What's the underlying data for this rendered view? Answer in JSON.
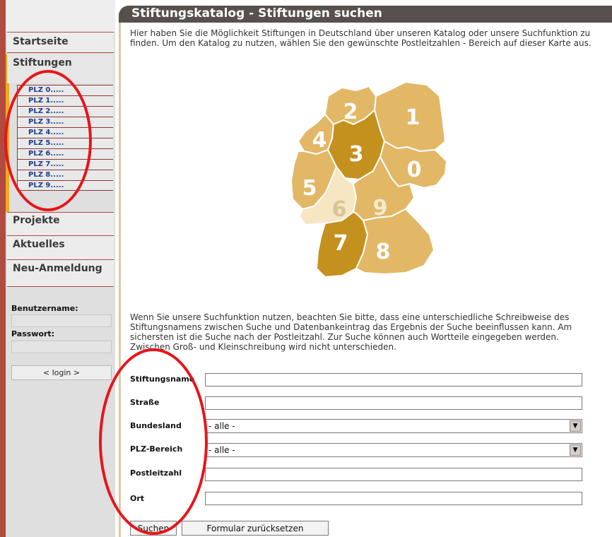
{
  "title": "Stiftungskatalog - Stiftungen suchen",
  "sidebar": {
    "nav": {
      "startseite": "Startseite",
      "stiftungen": "Stiftungen",
      "projekte": "Projekte",
      "aktuelles": "Aktuelles",
      "neu_anmeldung": "Neu-Anmeldung"
    },
    "plz_items": [
      "PLZ 0.....",
      "PLZ 1.....",
      "PLZ 2.....",
      "PLZ 3.....",
      "PLZ 4.....",
      "PLZ 5.....",
      "PLZ 6.....",
      "PLZ 7.....",
      "PLZ 8.....",
      "PLZ 9....."
    ],
    "login": {
      "username_label": "Benutzername:",
      "password_label": "Passwort:",
      "button": "< login >"
    }
  },
  "intro_text": "Hier haben Sie die Möglichkeit Stiftungen in Deutschland über unseren Katalog oder unsere Suchfunktion zu finden. Um den Katalog zu nutzen, wählen Sie den gewünschte Postleitzahlen - Bereich auf dieser Karte aus.",
  "map": {
    "region_numbers": [
      "0",
      "1",
      "2",
      "3",
      "4",
      "5",
      "6",
      "7",
      "8",
      "9"
    ]
  },
  "search_hint": "Wenn Sie unsere Suchfunktion nutzen, beachten Sie bitte, dass eine unterschiedliche Schreibweise des Stiftungsnamens zwischen Suche und Datenbankeintrag das Ergebnis der Suche beeinflussen kann. Am sichersten ist die Suche nach der Postleitzahl. Zur Suche können auch Wortteile eingegeben werden. Zwischen Groß- und Kleinschreibung wird nicht unterschieden.",
  "form": {
    "stiftungsname_label": "Stiftungsname",
    "strasse_label": "Straße",
    "bundesland_label": "Bundesland",
    "bundesland_value": "- alle -",
    "plz_bereich_label": "PLZ-Bereich",
    "plz_bereich_value": "- alle -",
    "postleitzahl_label": "Postleitzahl",
    "ort_label": "Ort",
    "search_button": "Suchen",
    "reset_button": "Formular zurücksetzen"
  },
  "colors": {
    "title_bar": "#57504c",
    "sidebar_accent": "#b14a3f",
    "plz_link": "#1e3c8e",
    "annotation": "#e8141a",
    "map_region_dark": "#c4901e",
    "map_region_light": "#e2b766"
  }
}
